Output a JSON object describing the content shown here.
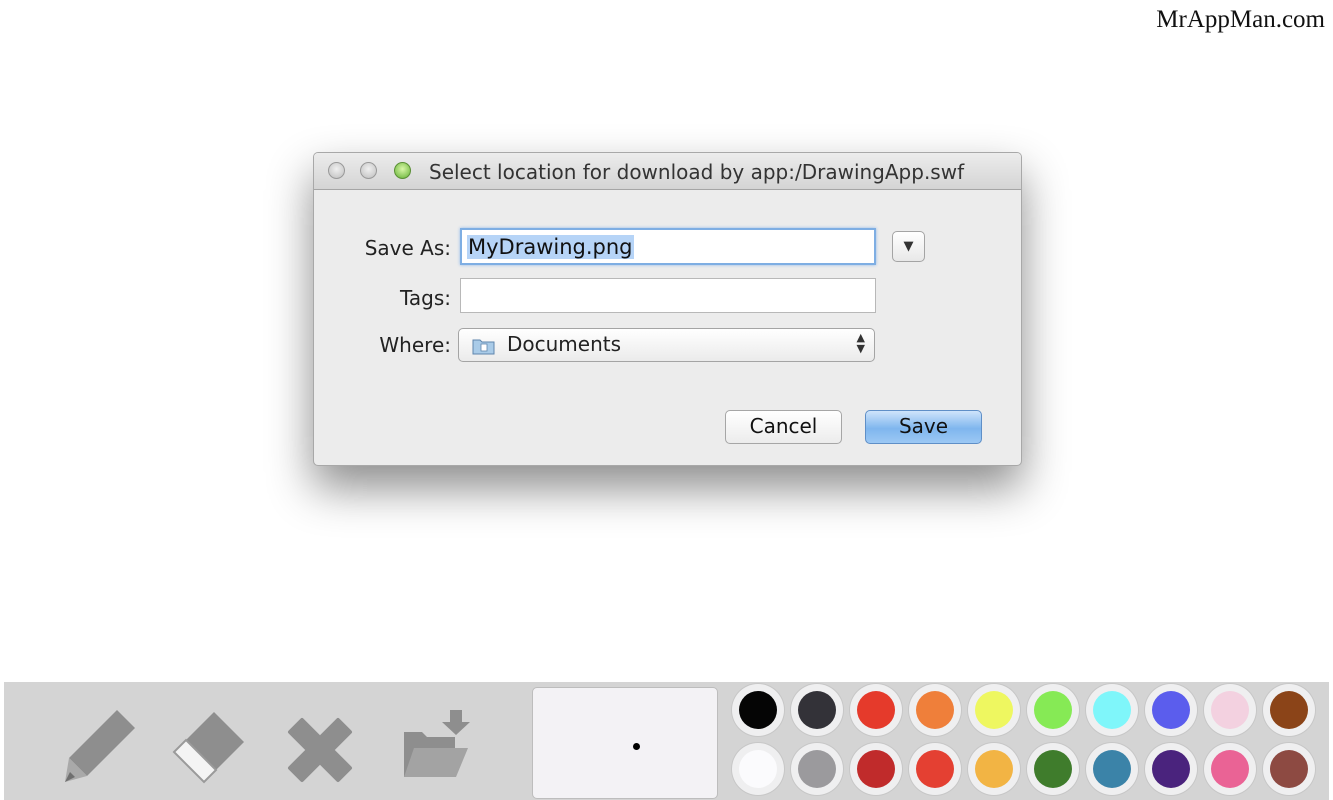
{
  "watermark": "MrAppMan.com",
  "dialog": {
    "title": "Select location for download by app:/DrawingApp.swf",
    "save_as_label": "Save As:",
    "save_as_value": "MyDrawing.png",
    "tags_label": "Tags:",
    "tags_value": "",
    "where_label": "Where:",
    "where_value": "Documents",
    "expand_icon": "triangle-down",
    "cancel_label": "Cancel",
    "save_label": "Save"
  },
  "toolbar": {
    "tools": [
      "pencil-icon",
      "eraser-icon",
      "clear-icon",
      "save-to-folder-icon"
    ],
    "palette": [
      "#050505",
      "#333238",
      "#e53a2b",
      "#ef7f3a",
      "#eef760",
      "#86ea55",
      "#7ff6fa",
      "#5b5ded",
      "#f3d1e0",
      "#8b4418",
      "#fbfbfd",
      "#9b9a9d",
      "#c02b2b",
      "#e44032",
      "#f2b444",
      "#3f7c2c",
      "#3b83a8",
      "#4a237d",
      "#ea6395",
      "#8d4a42"
    ]
  }
}
